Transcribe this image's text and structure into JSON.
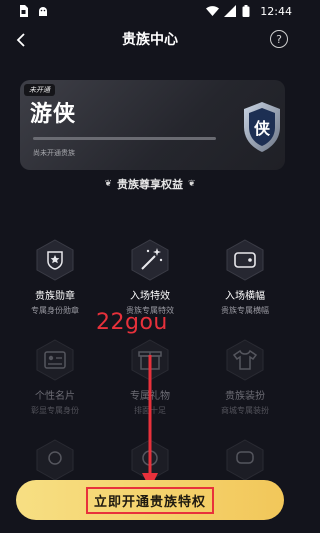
{
  "status_bar": {
    "time": "12:44"
  },
  "nav": {
    "title": "贵族中心",
    "help_label": "?"
  },
  "card": {
    "tag": "未开通",
    "name": "游侠",
    "badge_char": "侠",
    "status": "尚未开通贵族"
  },
  "section": {
    "title": "贵族尊享权益"
  },
  "perks": [
    {
      "name": "贵族勋章",
      "desc": "专属身份勋章",
      "icon": "medal-icon",
      "active": true
    },
    {
      "name": "入场特效",
      "desc": "贵族专属特效",
      "icon": "magic-wand-icon",
      "active": true
    },
    {
      "name": "入场横幅",
      "desc": "贵族专属横幅",
      "icon": "banner-icon",
      "active": true
    },
    {
      "name": "个性名片",
      "desc": "彰显专属身份",
      "icon": "name-card-icon",
      "active": false
    },
    {
      "name": "专属礼物",
      "desc": "排面十足",
      "icon": "gift-icon",
      "active": false
    },
    {
      "name": "贵族装扮",
      "desc": "商城专属装扮",
      "icon": "tshirt-icon",
      "active": false
    }
  ],
  "watermark": "22gou",
  "cta": {
    "label": "立即开通贵族特权"
  },
  "colors": {
    "accent": "#f2c75a",
    "annotation_red": "#e8313b",
    "background": "#13141c"
  }
}
